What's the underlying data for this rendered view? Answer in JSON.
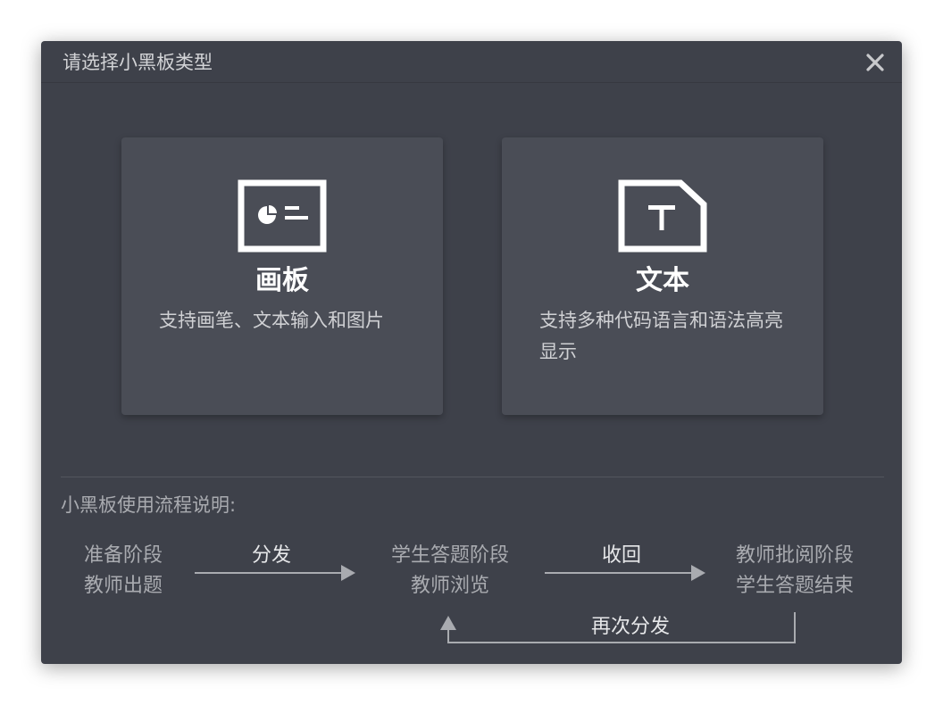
{
  "dialog": {
    "title": "请选择小黑板类型"
  },
  "cards": [
    {
      "icon": "whiteboard-icon",
      "name": "画板",
      "description": "支持画笔、文本输入和图片"
    },
    {
      "icon": "text-document-icon",
      "name": "文本",
      "description": "支持多种代码语言和语法高亮显示"
    }
  ],
  "flow": {
    "title": "小黑板使用流程说明:",
    "stages": [
      {
        "line1": "准备阶段",
        "line2": "教师出题"
      },
      {
        "line1": "学生答题阶段",
        "line2": "教师浏览"
      },
      {
        "line1": "教师批阅阶段",
        "line2": "学生答题结束"
      }
    ],
    "arrows": [
      "分发",
      "收回",
      "再次分发"
    ]
  },
  "colors": {
    "background": "#3e414a",
    "card": "#4a4d56",
    "text_muted": "#a9abb0",
    "text_bright": "#ffffff"
  }
}
